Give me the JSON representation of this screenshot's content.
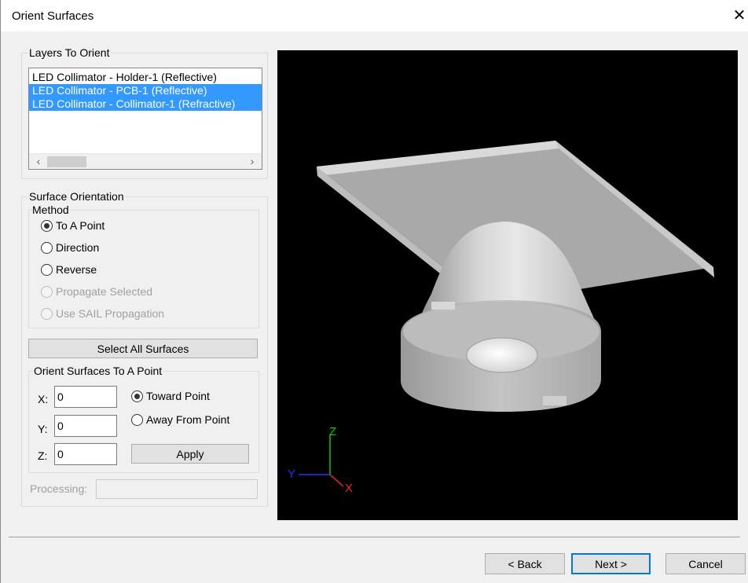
{
  "window": {
    "title": "Orient Surfaces",
    "close_glyph": "✕"
  },
  "layers": {
    "legend": "Layers To Orient",
    "items": [
      {
        "label": "LED Collimator - Holder-1 (Reflective)",
        "selected": false
      },
      {
        "label": "LED Collimator - PCB-1 (Reflective)",
        "selected": true
      },
      {
        "label": "LED Collimator - Collimator-1 (Refractive)",
        "selected": true
      }
    ],
    "scroll_left": "‹",
    "scroll_right": "›"
  },
  "surface_orientation": {
    "legend": "Surface Orientation",
    "method_legend": "Method",
    "methods": [
      {
        "label": "To A Point",
        "checked": true,
        "enabled": true
      },
      {
        "label": "Direction",
        "checked": false,
        "enabled": true
      },
      {
        "label": "Reverse",
        "checked": false,
        "enabled": true
      },
      {
        "label": "Propagate Selected",
        "checked": false,
        "enabled": false
      },
      {
        "label": "Use SAIL Propagation",
        "checked": false,
        "enabled": false
      }
    ],
    "select_all_label": "Select All Surfaces"
  },
  "orient_to_point": {
    "legend": "Orient Surfaces To A Point",
    "x_label": "X:",
    "x_value": "0",
    "y_label": "Y:",
    "y_value": "0",
    "z_label": "Z:",
    "z_value": "0",
    "toward_label": "Toward Point",
    "away_label": "Away From Point",
    "apply_label": "Apply"
  },
  "processing": {
    "label": "Processing:",
    "value": ""
  },
  "viewport": {
    "axis_z": "Z",
    "axis_y": "Y",
    "axis_x": "X",
    "axis_colors": {
      "z": "#00cc00",
      "y": "#2233ff",
      "x": "#ff2020"
    },
    "background": "#000000"
  },
  "footer": {
    "back_label": "< Back",
    "next_label": "Next >",
    "cancel_label": "Cancel"
  },
  "colors": {
    "selection": "#3399ff",
    "dialog_bg": "#f0f0f0",
    "default_button_border": "#0078d7"
  }
}
